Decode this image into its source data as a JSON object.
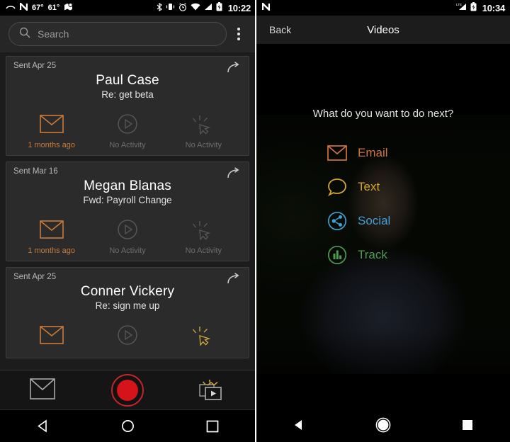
{
  "left": {
    "status_bar": {
      "icons": [
        "call-end-icon",
        "nova-launcher-icon",
        "maps-icon",
        "bluetooth-icon",
        "vibrate-icon",
        "alarm-icon",
        "wifi-icon",
        "signal-icon",
        "battery-charging-icon"
      ],
      "temp_high": "67°",
      "temp_low": "61°",
      "time": "10:22"
    },
    "search": {
      "placeholder": "Search",
      "icon": "search-icon"
    },
    "overflow_menu": "overflow-menu-icon",
    "cards": [
      {
        "sent": "Sent Apr 25",
        "name": "Paul Case",
        "subject": "Re: get beta",
        "reply_icon": "reply-forward-icon",
        "stats": [
          {
            "icon": "envelope-icon",
            "label": "1 months ago",
            "state": "active"
          },
          {
            "icon": "play-circle-icon",
            "label": "No Activity",
            "state": "inactive"
          },
          {
            "icon": "cursor-click-icon",
            "label": "No Activity",
            "state": "inactive"
          }
        ]
      },
      {
        "sent": "Sent Mar 16",
        "name": "Megan Blanas",
        "subject": "Fwd: Payroll Change",
        "reply_icon": "reply-forward-icon",
        "stats": [
          {
            "icon": "envelope-icon",
            "label": "1 months ago",
            "state": "active"
          },
          {
            "icon": "play-circle-icon",
            "label": "No Activity",
            "state": "inactive"
          },
          {
            "icon": "cursor-click-icon",
            "label": "No Activity",
            "state": "inactive"
          }
        ]
      },
      {
        "sent": "Sent Apr 25",
        "name": "Conner Vickery",
        "subject": "Re: sign me up",
        "reply_icon": "reply-forward-icon",
        "stats": [
          {
            "icon": "envelope-icon",
            "label": "",
            "state": "active"
          },
          {
            "icon": "play-circle-icon",
            "label": "",
            "state": "inactive"
          },
          {
            "icon": "cursor-click-icon",
            "label": "",
            "state": "inactive"
          }
        ]
      }
    ],
    "action_bar": {
      "compose_icon": "envelope-icon",
      "record_icon": "record-button-icon",
      "library_icon": "video-library-icon"
    },
    "nav_bar": {
      "back": "back-triangle-icon",
      "home": "home-circle-icon",
      "recents": "recents-square-icon"
    }
  },
  "right": {
    "status_bar": {
      "icons": [
        "nova-launcher-icon",
        "lte-signal-icon",
        "battery-charging-icon"
      ],
      "time": "10:34"
    },
    "title_bar": {
      "back_label": "Back",
      "title": "Videos"
    },
    "overlay": {
      "question": "What do you want to do next?",
      "menu": [
        {
          "label": "Email",
          "icon": "envelope-icon",
          "color": "#d2743a"
        },
        {
          "label": "Text",
          "icon": "speech-bubble-icon",
          "color": "#d4a72c"
        },
        {
          "label": "Social",
          "icon": "share-node-icon",
          "color": "#3d9fd4"
        },
        {
          "label": "Track",
          "icon": "bar-chart-icon",
          "color": "#4e9a4e"
        }
      ]
    },
    "nav_bar": {
      "back": "back-triangle-icon",
      "home": "home-circle-icon",
      "recents": "recents-square-icon"
    }
  },
  "colors": {
    "accent_orange": "#c97b3c",
    "record_red": "#d6121a",
    "inactive_gray": "#6d6d6d"
  }
}
